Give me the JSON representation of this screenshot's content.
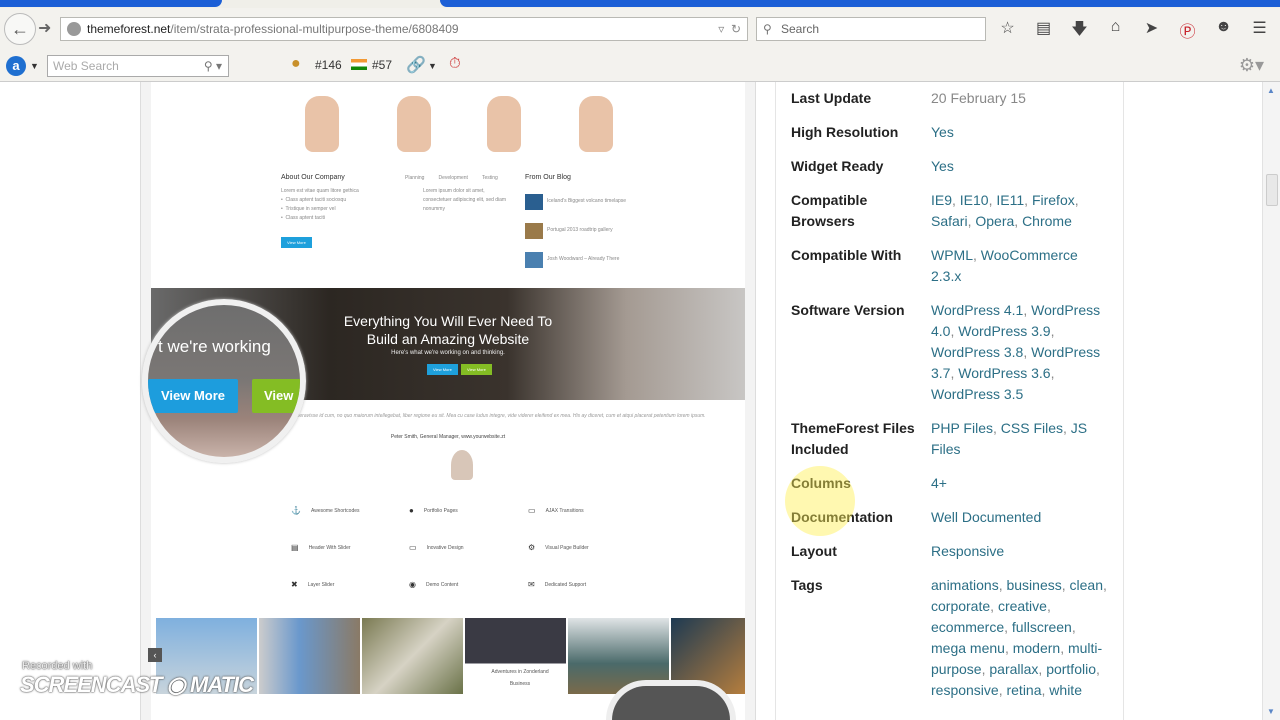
{
  "browser": {
    "url_domain": "themeforest.net",
    "url_path": "/item/strata-professional-multipurpose-theme/6808409",
    "search_placeholder": "Search",
    "toolbar_icons": [
      "star-icon",
      "reading-list-icon",
      "download-icon",
      "home-icon",
      "send-icon",
      "pinterest-icon",
      "chat-icon",
      "menu-icon"
    ]
  },
  "addon_bar": {
    "web_search_placeholder": "Web Search",
    "global_rank": "#146",
    "country_rank": "#57"
  },
  "preview": {
    "about_title": "About Our Company",
    "tabs": [
      "Planning",
      "Development",
      "Testing"
    ],
    "blog_title": "From Our Blog",
    "blog_posts": [
      "Iceland's Biggest volcano timelapse",
      "Portugal 2013 roadtrip gallery",
      "Josh Woodward – Already There"
    ],
    "view_more": "View More",
    "hero_title_1": "Everything You Will Ever Need To",
    "hero_title_2": "Build an Amazing Website",
    "hero_sub": "Here's what we're working on and thinking.",
    "quote": "Lorem ipsum dolor sit amet, feugiat delicata liberavisse id cum, no quo maiorum intellegebat, liber regione eu sit. Mea cu case ludus integre, vide viderer eleifend ex mea. His ay diceret, cum et atqui placerat petentium lorem ipsum.",
    "quote_author": "Peter Smith, General Manager, www.yourwebsite.zt",
    "features": [
      "Awesome Shortcodes",
      "Portfolio Pages",
      "AJAX Transitions",
      "Header With Slider",
      "Inovative Design",
      "Visual Page Builder",
      "Layer Slider",
      "Demo Content",
      "Dedicated Support"
    ],
    "gallery_caption": "Adventures in Zonderland",
    "gallery_category": "Business",
    "magnifier_text": "t we're working",
    "magnifier_btn1": "View More",
    "magnifier_btn2": "View"
  },
  "details": [
    {
      "label": "Last Update",
      "values": [
        "20 February 15"
      ],
      "plain": true
    },
    {
      "label": "High Resolution",
      "values": [
        "Yes"
      ]
    },
    {
      "label": "Widget Ready",
      "values": [
        "Yes"
      ]
    },
    {
      "label": "Compatible Browsers",
      "values": [
        "IE9",
        "IE10",
        "IE11",
        "Firefox",
        "Safari",
        "Opera",
        "Chrome"
      ]
    },
    {
      "label": "Compatible With",
      "values": [
        "WPML",
        "WooCommerce 2.3.x"
      ]
    },
    {
      "label": "Software Version",
      "values": [
        "WordPress 4.1",
        "WordPress 4.0",
        "WordPress 3.9",
        "WordPress 3.8",
        "WordPress 3.7",
        "WordPress 3.6",
        "WordPress 3.5"
      ]
    },
    {
      "label": "ThemeForest Files Included",
      "values": [
        "PHP Files",
        "CSS Files",
        "JS Files"
      ]
    },
    {
      "label": "Columns",
      "values": [
        "4+"
      ]
    },
    {
      "label": "Documentation",
      "values": [
        "Well Documented"
      ]
    },
    {
      "label": "Layout",
      "values": [
        "Responsive"
      ]
    },
    {
      "label": "Tags",
      "values": [
        "animations",
        "business",
        "clean",
        "corporate",
        "creative",
        "ecommerce",
        "fullscreen",
        "mega menu",
        "modern",
        "multi-purpose",
        "parallax",
        "portfolio",
        "responsive",
        "retina",
        "white"
      ]
    }
  ],
  "watermark": {
    "recorded": "Recorded with",
    "logo": "SCREENCAST-O-MATIC"
  }
}
